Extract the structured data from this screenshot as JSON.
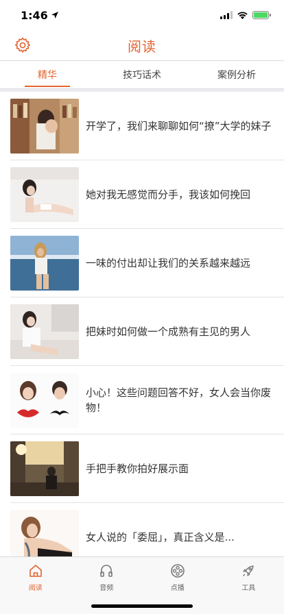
{
  "status_bar": {
    "time": "1:46"
  },
  "header": {
    "title": "阅读"
  },
  "tabs": [
    {
      "label": "精华",
      "active": true
    },
    {
      "label": "技巧话术",
      "active": false
    },
    {
      "label": "案例分析",
      "active": false
    }
  ],
  "articles": [
    {
      "title": "开学了，我们来聊聊如何“撩”大学的妹子"
    },
    {
      "title": "她对我无感觉而分手，我该如何挽回"
    },
    {
      "title": "一味的付出却让我们的关系越来越远"
    },
    {
      "title": "把妹时如何做一个成熟有主见的男人"
    },
    {
      "title": "小心！这些问题回答不好，女人会当你废物！"
    },
    {
      "title": "手把手教你拍好展示面"
    },
    {
      "title": "女人说的「委屈」，真正含义是..."
    }
  ],
  "tab_bar": [
    {
      "label": "阅读",
      "icon": "home-icon",
      "active": true
    },
    {
      "label": "音频",
      "icon": "audio-icon",
      "active": false
    },
    {
      "label": "点播",
      "icon": "film-reel-icon",
      "active": false
    },
    {
      "label": "工具",
      "icon": "rocket-icon",
      "active": false
    }
  ],
  "colors": {
    "accent": "#e2632f",
    "separator": "#e2e2e2",
    "tab_bar_bg": "#f8f8f8"
  }
}
